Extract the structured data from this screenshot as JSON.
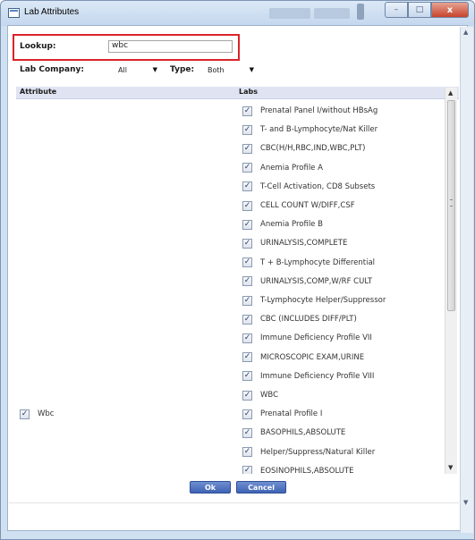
{
  "window": {
    "title": "Lab Attributes",
    "minimize_glyph": "–",
    "maximize_glyph": "□",
    "close_glyph": "x"
  },
  "form": {
    "lookup_label": "Lookup:",
    "lookup_value": "wbc",
    "lab_company_label": "Lab Company:",
    "lab_company_value": "All",
    "type_label": "Type:",
    "type_value": "Both"
  },
  "table": {
    "attribute_header": "Attribute",
    "labs_header": "Labs",
    "attributes": [
      {
        "label": "Wbc",
        "checked": true
      }
    ],
    "labs": [
      {
        "label": "Prenatal Panel I/without HBsAg",
        "checked": true
      },
      {
        "label": "T- and B-Lymphocyte/Nat Killer",
        "checked": true
      },
      {
        "label": "CBC(H/H,RBC,IND,WBC,PLT)",
        "checked": true
      },
      {
        "label": "Anemia Profile A",
        "checked": true
      },
      {
        "label": "T-Cell Activation, CD8 Subsets",
        "checked": true
      },
      {
        "label": "CELL COUNT W/DIFF,CSF",
        "checked": true
      },
      {
        "label": "Anemia Profile B",
        "checked": true
      },
      {
        "label": "URINALYSIS,COMPLETE",
        "checked": true
      },
      {
        "label": "T + B-Lymphocyte Differential",
        "checked": true
      },
      {
        "label": "URINALYSIS,COMP,W/RF CULT",
        "checked": true
      },
      {
        "label": "T-Lymphocyte Helper/Suppressor",
        "checked": true
      },
      {
        "label": "CBC (INCLUDES DIFF/PLT)",
        "checked": true
      },
      {
        "label": "Immune Deficiency Profile VII",
        "checked": true
      },
      {
        "label": "MICROSCOPIC EXAM,URINE",
        "checked": true
      },
      {
        "label": "Immune Deficiency Profile VIII",
        "checked": true
      },
      {
        "label": "WBC",
        "checked": true
      },
      {
        "label": "Prenatal Profile I",
        "checked": true
      },
      {
        "label": "BASOPHILS,ABSOLUTE",
        "checked": true
      },
      {
        "label": "Helper/Suppress/Natural Killer",
        "checked": true
      },
      {
        "label": "EOSINOPHILS,ABSOLUTE",
        "checked": true
      }
    ]
  },
  "buttons": {
    "ok_label": "Ok",
    "cancel_label": "Cancel"
  },
  "checkmark_glyph": "✓"
}
